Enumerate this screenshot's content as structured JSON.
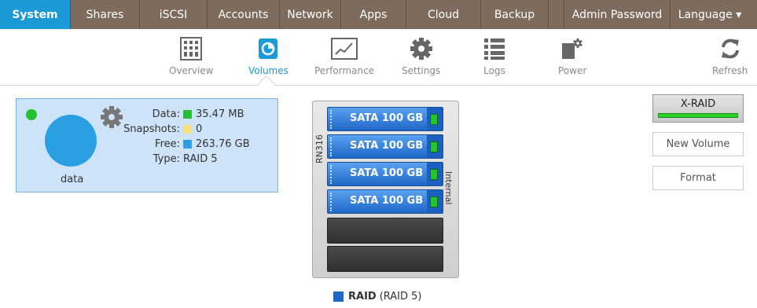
{
  "nav": {
    "tabs": [
      {
        "label": "System"
      },
      {
        "label": "Shares"
      },
      {
        "label": "iSCSI"
      },
      {
        "label": "Accounts"
      },
      {
        "label": "Network"
      },
      {
        "label": "Apps"
      },
      {
        "label": "Cloud"
      },
      {
        "label": "Backup"
      },
      {
        "label": "Admin Password"
      },
      {
        "label": "Language ▾"
      }
    ],
    "active": "System"
  },
  "toolbar": {
    "items": [
      {
        "label": "Overview",
        "icon": "grid-icon"
      },
      {
        "label": "Volumes",
        "icon": "pie-icon"
      },
      {
        "label": "Performance",
        "icon": "chart-icon"
      },
      {
        "label": "Settings",
        "icon": "gear-icon"
      },
      {
        "label": "Logs",
        "icon": "list-icon"
      },
      {
        "label": "Power",
        "icon": "power-icon"
      },
      {
        "label": "Refresh",
        "icon": "refresh-icon"
      }
    ],
    "active": "Volumes"
  },
  "volume": {
    "name": "data",
    "status_color": "#22c32e",
    "stats": [
      {
        "key": "Data:",
        "value": "35.47 MB",
        "color": "#22c32e"
      },
      {
        "key": "Snapshots:",
        "value": "0",
        "color": "#f5e07a"
      },
      {
        "key": "Free:",
        "value": "263.76 GB",
        "color": "#2aa0e2"
      },
      {
        "key": "Type:",
        "value": "RAID 5",
        "color": ""
      }
    ]
  },
  "enclosure": {
    "model": "RN316",
    "location": "Internal",
    "disks": [
      {
        "label": "SATA 100 GB"
      },
      {
        "label": "SATA 100 GB"
      },
      {
        "label": "SATA 100 GB"
      },
      {
        "label": "SATA 100 GB"
      }
    ],
    "empty_bays": 2,
    "raid_name": "RAID",
    "raid_level": "(RAID 5)"
  },
  "actions": {
    "xraid_label": "X-RAID",
    "new_volume_label": "New Volume",
    "format_label": "Format"
  }
}
